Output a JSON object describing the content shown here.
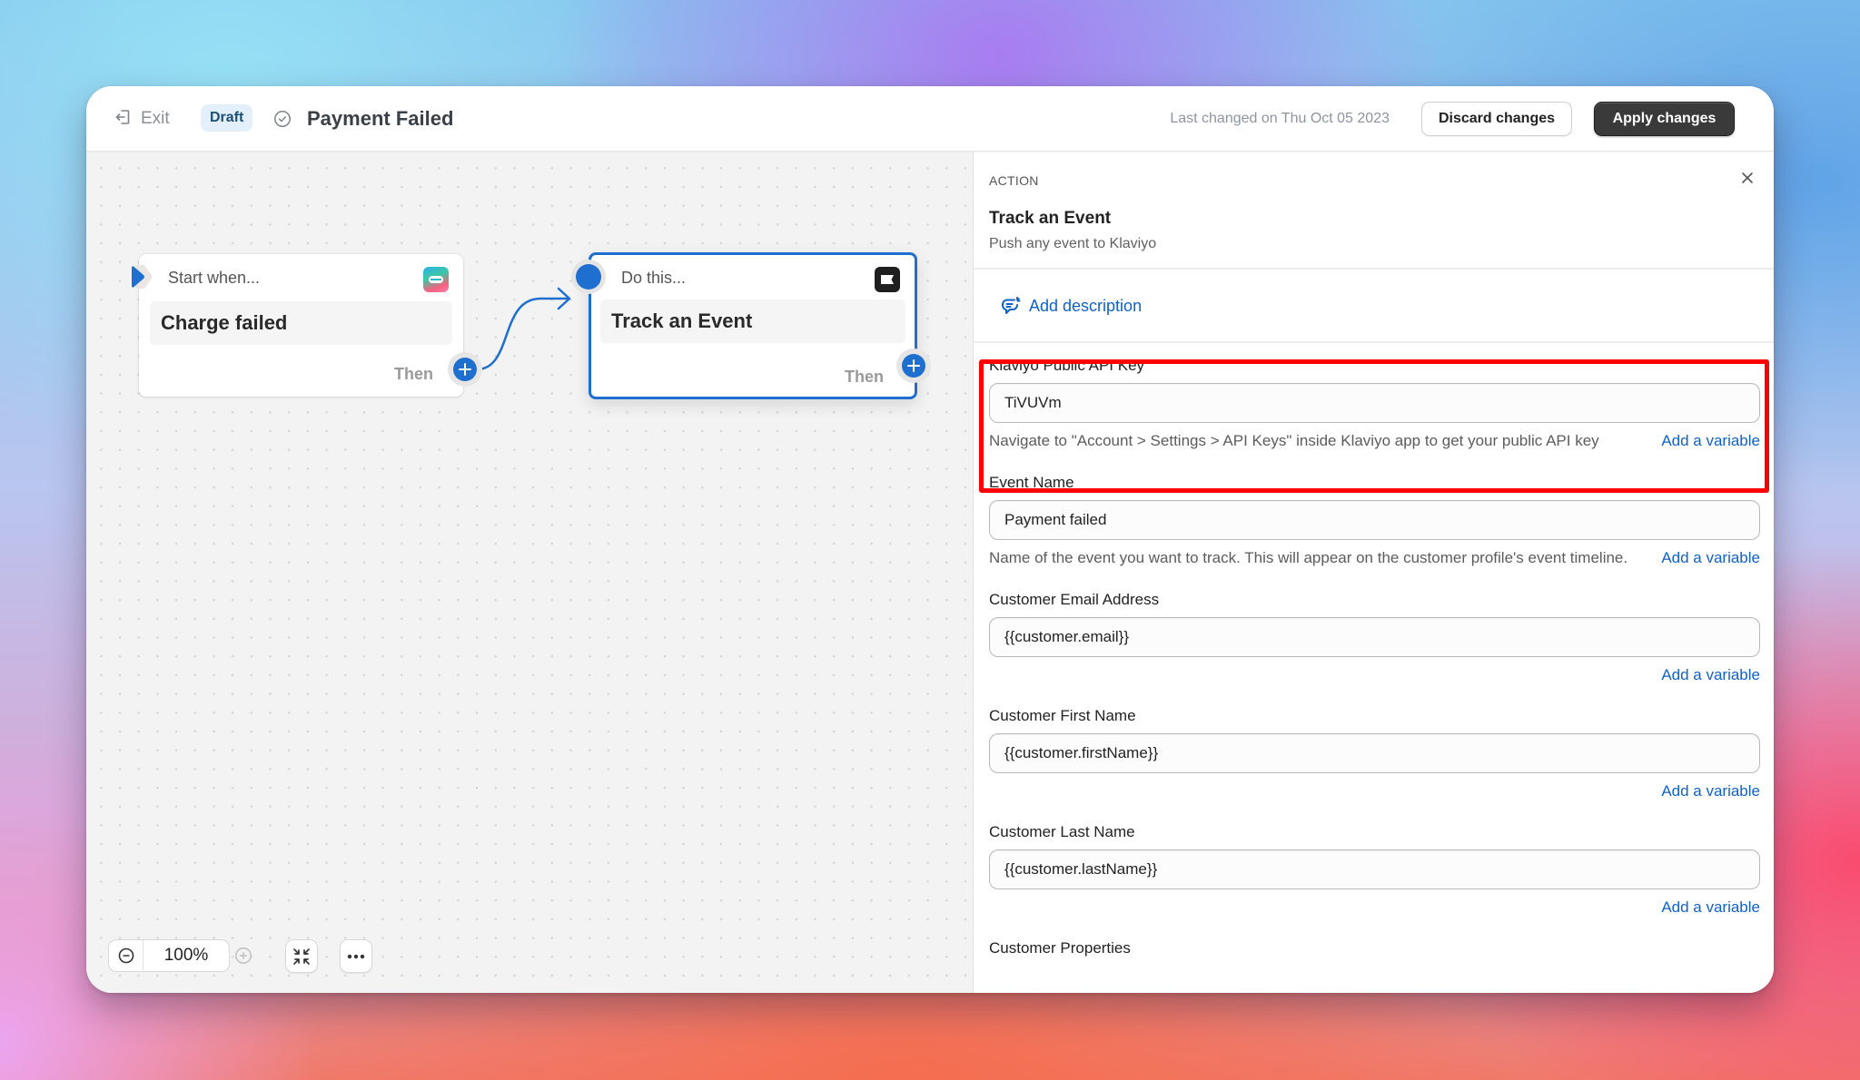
{
  "header": {
    "exit_label": "Exit",
    "status_badge": "Draft",
    "title": "Payment Failed",
    "last_changed": "Last changed on Thu Oct 05 2023",
    "discard_label": "Discard changes",
    "apply_label": "Apply changes"
  },
  "canvas": {
    "trigger_node": {
      "header": "Start when...",
      "title": "Charge failed",
      "then_label": "Then",
      "app_icon": "stripe-like-app-icon"
    },
    "action_node": {
      "header": "Do this...",
      "title": "Track an Event",
      "then_label": "Then",
      "app_icon": "klaviyo-flag-icon"
    },
    "zoom_level": "100%",
    "accent_color": "#1f6fd0"
  },
  "panel": {
    "kicker": "ACTION",
    "title": "Track an Event",
    "subtitle": "Push any event to Klaviyo",
    "add_description": "Add description",
    "fields": [
      {
        "label": "Klaviyo Public API Key",
        "value": "TiVUVm",
        "help": "Navigate to \"Account > Settings > API Keys\" inside Klaviyo app to get your public API key",
        "add_variable": "Add a variable",
        "highlighted": true
      },
      {
        "label": "Event Name",
        "value": "Payment failed",
        "help": "Name of the event you want to track. This will appear on the customer profile's event timeline.",
        "add_variable": "Add a variable"
      },
      {
        "label": "Customer Email Address",
        "value": "{{customer.email}}",
        "add_variable": "Add a variable"
      },
      {
        "label": "Customer First Name",
        "value": "{{customer.firstName}}",
        "add_variable": "Add a variable"
      },
      {
        "label": "Customer Last Name",
        "value": "{{customer.lastName}}",
        "add_variable": "Add a variable"
      },
      {
        "label": "Customer Properties"
      }
    ],
    "highlight_color": "#ff0000"
  }
}
